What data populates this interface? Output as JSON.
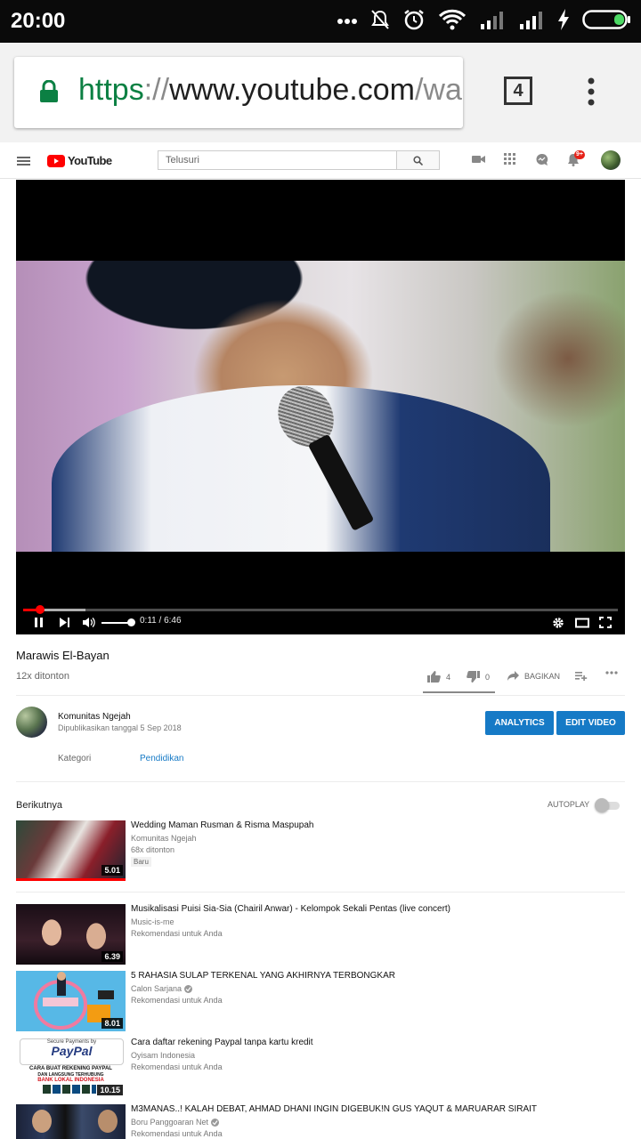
{
  "status_bar": {
    "time": "20:00",
    "icons": [
      "more-dots-icon",
      "muted-bell-icon",
      "alarm-icon",
      "wifi-icon",
      "signal-icon",
      "signal-icon",
      "charging-icon",
      "battery-icon"
    ]
  },
  "browser": {
    "url_scheme": "https",
    "url_sep": "://",
    "url_host": "www.youtube.com",
    "url_rest": "/wa",
    "tab_count": "4"
  },
  "youtube": {
    "logo_text": "YouTube",
    "search_placeholder": "Telusuri",
    "notification_badge": "9+"
  },
  "player": {
    "current_time": "0:11",
    "time_sep": " / ",
    "duration": "6:46",
    "progress": 0.028,
    "buffered": 0.105,
    "volume": 1.0
  },
  "video": {
    "title": "Marawis El-Bayan",
    "views": "12x ditonton",
    "likes": "4",
    "dislikes": "0",
    "share_label": "BAGIKAN"
  },
  "channel": {
    "name": "Komunitas Ngejah",
    "published": "Dipublikasikan tanggal 5 Sep 2018",
    "analytics_label": "ANALYTICS",
    "edit_label": "EDIT VIDEO",
    "category_label": "Kategori",
    "category_value": "Pendidikan"
  },
  "up_next": {
    "heading": "Berikutnya",
    "autoplay_label": "AUTOPLAY",
    "autoplay_on": false
  },
  "recommendations": [
    {
      "title": "Wedding Maman Rusman & Risma Maspupah",
      "channel": "Komunitas Ngejah",
      "meta": "68x ditonton",
      "badge": "Baru",
      "duration": "5.01",
      "verified": false
    },
    {
      "title": "Musikalisasi Puisi Sia-Sia (Chairil Anwar) - Kelompok Sekali Pentas (live concert)",
      "channel": "Music-is-me",
      "meta": "Rekomendasi untuk Anda",
      "duration": "6.39",
      "verified": false
    },
    {
      "title": "5 RAHASIA SULAP TERKENAL YANG AKHIRNYA TERBONGKAR",
      "channel": "Calon Sarjana",
      "meta": "Rekomendasi untuk Anda",
      "duration": "8.01",
      "verified": true
    },
    {
      "title": "Cara daftar rekening Paypal tanpa kartu kredit",
      "channel": "Oyisam Indonesia",
      "meta": "Rekomendasi untuk Anda",
      "duration": "10.15",
      "verified": false
    },
    {
      "title": "M3MANAS..! KALAH DEBAT, AHMAD DHANI INGIN DIGEBUK!N GUS YAQUT & MARUARAR SIRAIT",
      "channel": "Boru Panggoaran Net",
      "meta": "Rekomendasi untuk Anda",
      "duration": "",
      "verified": true
    }
  ],
  "thumb3_text": {
    "line1": "Secure Payments by",
    "brand": "PayPal",
    "line2": "CARA BUAT REKENING PAYPAL",
    "line3": "DAN LANGSUNG TERHUBUNG",
    "line4": "BANK LOKAL INDONESIA"
  },
  "colors": {
    "accent_blue": "#167ac6",
    "youtube_red": "#ff0000",
    "secure_green": "#0b8043"
  }
}
